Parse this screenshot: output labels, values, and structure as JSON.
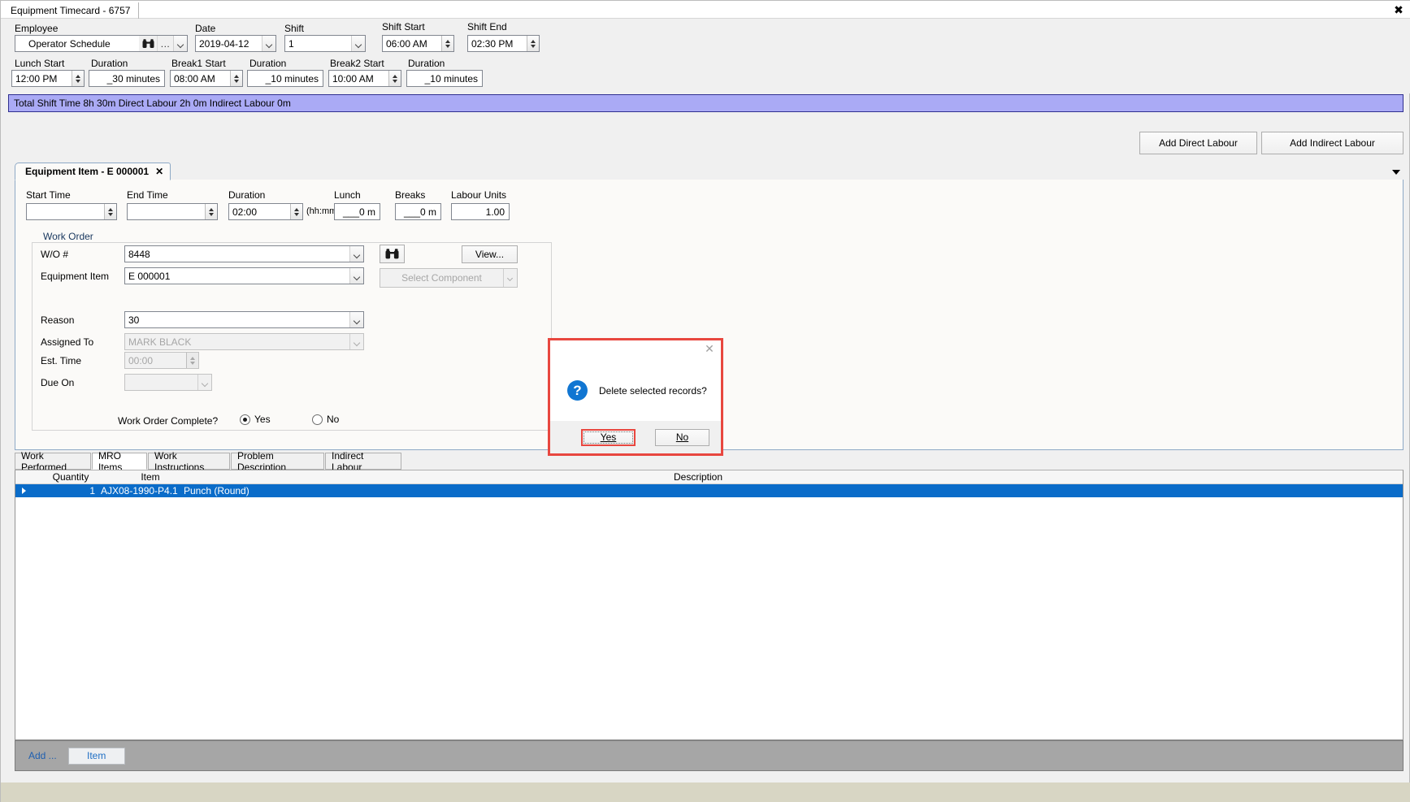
{
  "window": {
    "tab_title": "Equipment Timecard - 6757",
    "close_icon": "close-icon"
  },
  "header": {
    "employee_label": "Employee",
    "employee_value": "Operator Schedule",
    "date_label": "Date",
    "date_value": "2019-04-12",
    "shift_label": "Shift",
    "shift_value": "1",
    "shift_start_label": "Shift Start",
    "shift_start_value": "06:00 AM",
    "shift_end_label": "Shift End",
    "shift_end_value": "02:30 PM",
    "lunch_start_label": "Lunch Start",
    "lunch_start_value": "12:00 PM",
    "lunch_duration_label": "Duration",
    "lunch_duration_value": "_30 minutes",
    "break1_start_label": "Break1 Start",
    "break1_start_value": "08:00 AM",
    "break1_duration_label": "Duration",
    "break1_duration_value": "_10 minutes",
    "break2_start_label": "Break2 Start",
    "break2_start_value": "10:00 AM",
    "break2_duration_label": "Duration",
    "break2_duration_value": "_10 minutes",
    "ellipsis_label": "...",
    "total_bar": "Total Shift Time 8h 30m  Direct Labour 2h 0m  Indirect Labour 0m"
  },
  "toolbar": {
    "add_direct_labour": "Add Direct Labour",
    "add_indirect_labour": "Add Indirect Labour"
  },
  "item_tab": {
    "label": "Equipment Item - E 000001",
    "close": "✖"
  },
  "item_form": {
    "start_time_label": "Start Time",
    "start_time_value": "",
    "end_time_label": "End Time",
    "end_time_value": "",
    "duration_label": "Duration",
    "duration_value": "02:00",
    "duration_hint": "(hh:mm)",
    "lunch_label": "Lunch",
    "lunch_value": "___0 m",
    "breaks_label": "Breaks",
    "breaks_value": "___0 m",
    "labour_units_label": "Labour Units",
    "labour_units_value": "1.00"
  },
  "work_order": {
    "group_label": "Work Order",
    "wo_num_label": "W/O #",
    "wo_num_value": "8448",
    "search_icon": "binoculars-icon",
    "view_button": "View...",
    "equipment_item_label": "Equipment Item",
    "equipment_item_value": "E 000001",
    "select_component_label": "Select Component",
    "reason_label": "Reason",
    "reason_value": "30",
    "assigned_to_label": "Assigned To",
    "assigned_to_value": "MARK BLACK",
    "est_time_label": "Est. Time",
    "est_time_value": "00:00",
    "due_on_label": "Due On",
    "due_on_value": "",
    "complete_label": "Work Order Complete?",
    "complete_yes": "Yes",
    "complete_no": "No",
    "complete_selected": "Yes"
  },
  "bottom_tabs": [
    {
      "label": "Work Performed",
      "active": false
    },
    {
      "label": "MRO Items",
      "active": true
    },
    {
      "label": "Work Instructions",
      "active": false
    },
    {
      "label": "Problem Description",
      "active": false
    },
    {
      "label": "Indirect Labour",
      "active": false
    }
  ],
  "grid": {
    "columns": [
      "Quantity",
      "Item",
      "Description"
    ],
    "rows": [
      {
        "quantity": "1",
        "item": "AJX08-1990-P4.1",
        "description": "Punch (Round)",
        "selected": true
      }
    ]
  },
  "footer": {
    "add_label": "Add ...",
    "item_button": "Item"
  },
  "dialog": {
    "message": "Delete selected records?",
    "icon": "question-icon",
    "yes_label": "Yes",
    "no_label": "No",
    "close_icon": "close-icon",
    "highlight_color": "#e8473f",
    "default_button": "Yes"
  }
}
